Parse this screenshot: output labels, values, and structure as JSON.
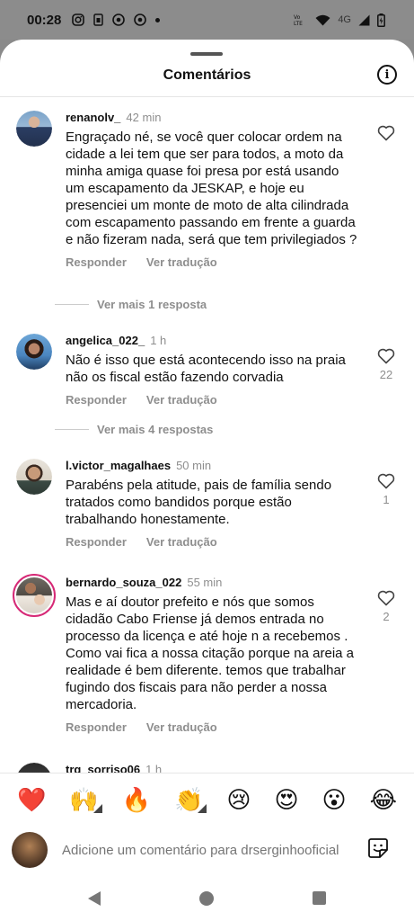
{
  "status": {
    "time": "00:28",
    "network": "4G"
  },
  "sheet": {
    "title": "Comentários"
  },
  "comments": [
    {
      "user": "renanolv_",
      "time": "42 min",
      "text": "Engraçado né, se você quer colocar ordem na cidade a lei tem que ser para todos, a moto da minha amiga quase foi presa por está usando um escapamento da JESKAP, e hoje eu presenciei um monte de moto de alta cilindrada com escapamento passando em frente a guarda e não fizeram nada, será que tem privilegiados ?",
      "reply_label": "Responder",
      "translate_label": "Ver tradução",
      "likes": "",
      "more_replies": "Ver mais 1 resposta"
    },
    {
      "user": "angelica_022_",
      "time": "1 h",
      "text": "Não é isso que está acontecendo isso na praia não os fiscal estão fazendo corvadia",
      "reply_label": "Responder",
      "translate_label": "Ver tradução",
      "likes": "22",
      "more_replies": "Ver mais 4 respostas"
    },
    {
      "user": "l.victor_magalhaes",
      "time": "50 min",
      "text": "Parabéns pela atitude, pais de família sendo tratados como bandidos porque estão trabalhando honestamente.",
      "reply_label": "Responder",
      "translate_label": "Ver tradução",
      "likes": "1"
    },
    {
      "user": "bernardo_souza_022",
      "time": "55 min",
      "text": "Mas e aí doutor prefeito e nós que somos cidadão Cabo Friense já demos entrada no processo da licença e até hoje n a recebemos . Como vai fica a nossa citação porque na areia a realidade é bem diferente. temos que trabalhar fugindo dos fiscais para não perder a nossa mercadoria.",
      "reply_label": "Responder",
      "translate_label": "Ver tradução",
      "likes": "2"
    },
    {
      "user": "trg_sorriso06",
      "time": "1 h"
    }
  ],
  "reactions": [
    "❤️",
    "🙌",
    "🔥",
    "👏",
    "😢",
    "😍",
    "😮",
    "😂"
  ],
  "compose": {
    "placeholder": "Adicione um comentário para drserginhooficial"
  },
  "colors": {
    "story_ring": "#d62976",
    "secondary_text": "#8e8e8e"
  },
  "icons": [
    "instagram-icon",
    "sim-icon",
    "chrome-icon",
    "wifi-icon",
    "signal-icon",
    "battery-icon",
    "info-icon",
    "heart-icon",
    "sticker-icon",
    "back-icon",
    "home-icon",
    "recents-icon"
  ]
}
